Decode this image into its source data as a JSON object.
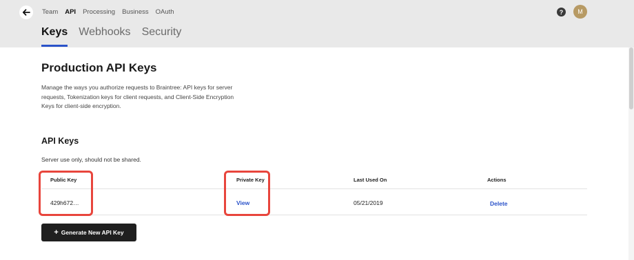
{
  "topnav": {
    "items": [
      "Team",
      "API",
      "Processing",
      "Business",
      "OAuth"
    ],
    "active_index": 1
  },
  "header": {
    "help_symbol": "?",
    "avatar_initial": "M"
  },
  "tabs": {
    "items": [
      "Keys",
      "Webhooks",
      "Security"
    ],
    "active_index": 0
  },
  "main": {
    "title": "Production API Keys",
    "description": "Manage the ways you authorize requests to Braintree: API keys for server requests, Tokenization keys for client requests, and Client-Side Encryption Keys for client-side encryption."
  },
  "api_keys": {
    "title": "API Keys",
    "subtitle": "Server use only, should not be shared.",
    "columns": [
      "Public Key",
      "Private Key",
      "Last Used On",
      "Actions"
    ],
    "rows": [
      {
        "public_key": "429h672…",
        "private_key_action": "View",
        "last_used": "05/21/2019",
        "action": "Delete"
      }
    ],
    "generate_button": "Generate New API Key"
  },
  "colors": {
    "accent": "#2a52c9",
    "highlight": "#e8453c",
    "header_bg": "#e9e9e9"
  }
}
